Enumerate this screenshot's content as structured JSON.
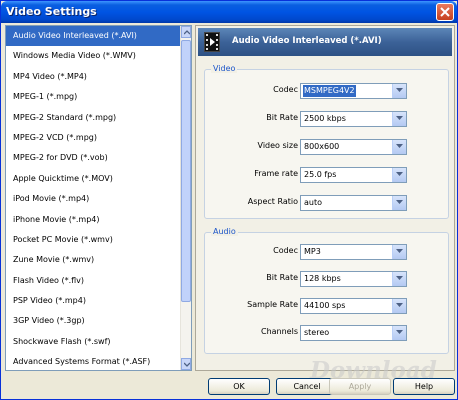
{
  "window": {
    "title": "Video Settings"
  },
  "formats": [
    "Audio Video Interleaved (*.AVI)",
    "Windows Media Video (*.WMV)",
    "MP4 Video (*.MP4)",
    "MPEG-1 (*.mpg)",
    "MPEG-2 Standard (*.mpg)",
    "MPEG-2 VCD (*.mpg)",
    "MPEG-2 for DVD (*.vob)",
    "Apple Quicktime (*.MOV)",
    "iPod Movie (*.mp4)",
    "iPhone Movie (*.mp4)",
    "Pocket PC Movie (*.wmv)",
    "Zune Movie (*.wmv)",
    "Flash Video (*.flv)",
    "PSP Video (*.mp4)",
    "3GP Video (*.3gp)",
    "Shockwave Flash (*.swf)",
    "Advanced Systems Format (*.ASF)"
  ],
  "selected_format_index": 0,
  "panel": {
    "header": "Audio Video Interleaved (*.AVI)"
  },
  "video": {
    "group_label": "Video",
    "codec": {
      "label": "Codec",
      "value": "MSMPEG4V2"
    },
    "bitrate": {
      "label": "Bit Rate",
      "value": "2500 kbps"
    },
    "size": {
      "label": "Video size",
      "value": "800x600"
    },
    "framerate": {
      "label": "Frame rate",
      "value": "25.0 fps"
    },
    "aspect": {
      "label": "Aspect Ratio",
      "value": "auto"
    }
  },
  "audio": {
    "group_label": "Audio",
    "codec": {
      "label": "Codec",
      "value": "MP3"
    },
    "bitrate": {
      "label": "Bit Rate",
      "value": "128 kbps"
    },
    "samplerate": {
      "label": "Sample Rate",
      "value": "44100 sps"
    },
    "channels": {
      "label": "Channels",
      "value": "stereo"
    }
  },
  "buttons": {
    "ok": "OK",
    "cancel": "Cancel",
    "apply": "Apply",
    "help": "Help"
  },
  "watermark": "Download"
}
